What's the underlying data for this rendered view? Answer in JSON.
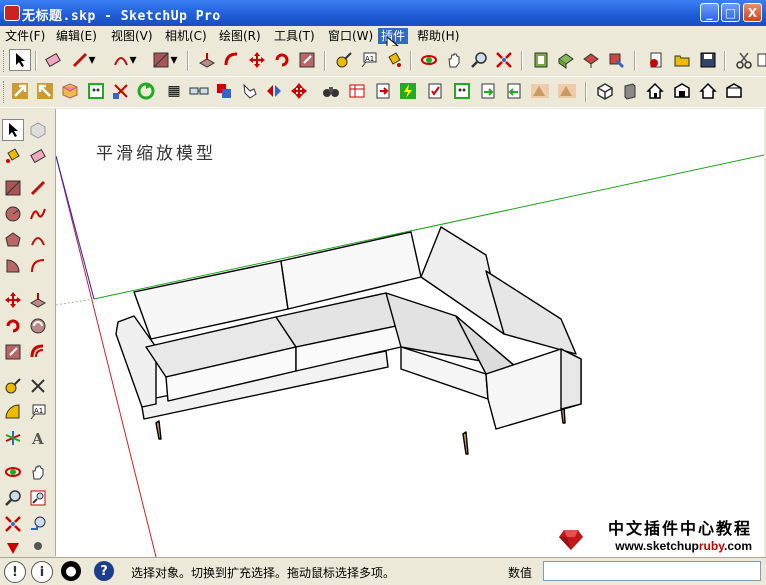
{
  "window": {
    "title": "无标题.skp - SketchUp Pro",
    "minimize": "_",
    "maximize": "□",
    "close": "X"
  },
  "menus": [
    "文件(F)",
    "编辑(E)",
    "视图(V)",
    "相机(C)",
    "绘图(R)",
    "工具(T)",
    "窗口(W)",
    "插件",
    "帮助(H)"
  ],
  "active_menu": "插件",
  "viewport": {
    "scene_title": "平滑缩放模型",
    "watermark_cn": "中文插件中心教程",
    "watermark_url_prefix": "www.sketchup",
    "watermark_url_ruby": "ruby",
    "watermark_url_suffix": ".com"
  },
  "status": {
    "message": "选择对象。切换到扩充选择。拖动鼠标选择多项。",
    "vcb_label": "数值",
    "vcb_value": ""
  },
  "colors": {
    "title_bar": "#1e5cd6",
    "menu_highlight": "#316ac5",
    "axis_red": "#d02020",
    "axis_green": "#20a020",
    "axis_blue": "#2020d0"
  }
}
